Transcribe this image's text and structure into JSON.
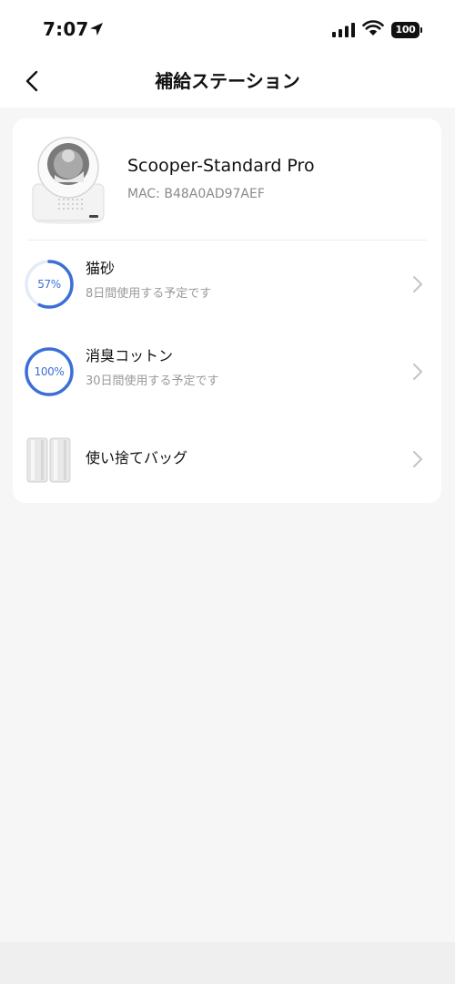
{
  "status_bar": {
    "time": "7:07",
    "battery": "100",
    "icons": [
      "location-arrow-icon",
      "signal-icon",
      "wifi-icon",
      "battery-icon"
    ]
  },
  "header": {
    "title": "補給ステーション",
    "back_icon": "chevron-left-icon"
  },
  "device": {
    "name": "Scooper-Standard Pro",
    "mac": "MAC: B48A0AD97AEF",
    "image": "litter-box-image"
  },
  "supplies": [
    {
      "name": "猫砂",
      "percent_label": "57%",
      "level": 0.57,
      "subtitle": "8日間使用する予定です"
    },
    {
      "name": "消臭コットン",
      "percent_label": "100%",
      "level": 1.0,
      "subtitle": "30日間使用する予定です"
    },
    {
      "name": "使い捨てバッグ",
      "image": "disposable-bags-image"
    }
  ],
  "colors": {
    "accent": "#3b6fd8",
    "ring_track": "#e3ebfa",
    "background": "#f6f6f6",
    "card": "#ffffff",
    "muted_text": "#999999"
  }
}
